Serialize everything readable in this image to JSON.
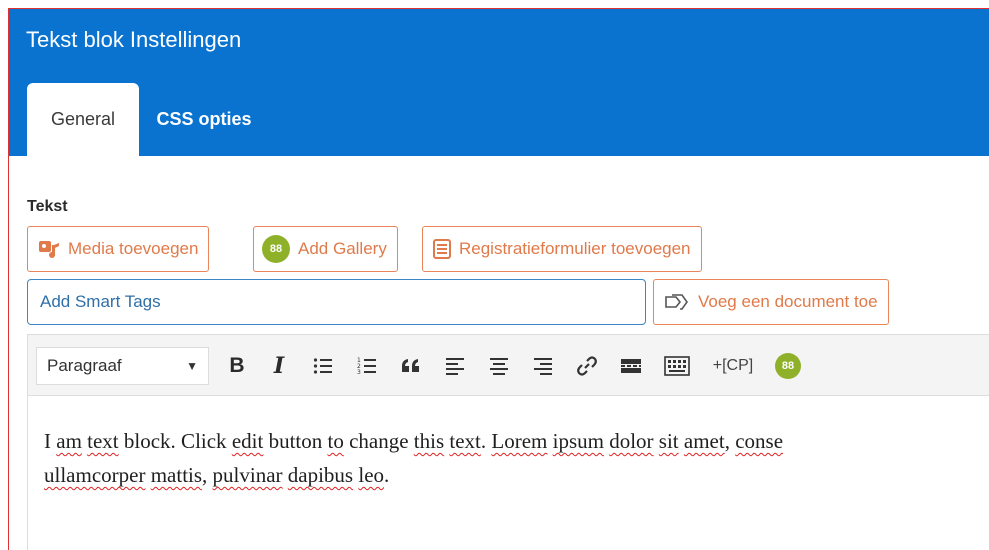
{
  "header": {
    "title": "Tekst blok Instellingen",
    "tabs": [
      {
        "label": "General",
        "active": true
      },
      {
        "label": "CSS opties",
        "active": false
      }
    ]
  },
  "field": {
    "label": "Tekst"
  },
  "buttons": {
    "media": "Media toevoegen",
    "gallery": "Add Gallery",
    "gallery_badge": "88",
    "registration": "Registratieformulier toevoegen",
    "document": "Voeg een document toe"
  },
  "smart_tags": {
    "value": "Add Smart Tags"
  },
  "toolbar": {
    "format_value": "Paragraaf",
    "bold_label": "B",
    "italic_label": "I",
    "cp_label": "+[CP]",
    "plugin_badge": "88"
  },
  "editor": {
    "line1": [
      {
        "t": "I ",
        "sq": false
      },
      {
        "t": "am",
        "sq": true
      },
      {
        "t": " ",
        "sq": false
      },
      {
        "t": "text",
        "sq": true
      },
      {
        "t": " block. Click ",
        "sq": false
      },
      {
        "t": "edit",
        "sq": true
      },
      {
        "t": " button ",
        "sq": false
      },
      {
        "t": "to",
        "sq": true
      },
      {
        "t": " change ",
        "sq": false
      },
      {
        "t": "this",
        "sq": true
      },
      {
        "t": " ",
        "sq": false
      },
      {
        "t": "text",
        "sq": true
      },
      {
        "t": ". ",
        "sq": false
      },
      {
        "t": "Lorem",
        "sq": true
      },
      {
        "t": " ",
        "sq": false
      },
      {
        "t": "ipsum",
        "sq": true
      },
      {
        "t": " ",
        "sq": false
      },
      {
        "t": "dolor",
        "sq": true
      },
      {
        "t": " ",
        "sq": false
      },
      {
        "t": "sit",
        "sq": true
      },
      {
        "t": " ",
        "sq": false
      },
      {
        "t": "amet",
        "sq": true
      },
      {
        "t": ", ",
        "sq": false
      },
      {
        "t": "conse",
        "sq": true
      }
    ],
    "line2": [
      {
        "t": "ullamcorper",
        "sq": true
      },
      {
        "t": " ",
        "sq": false
      },
      {
        "t": "mattis",
        "sq": true
      },
      {
        "t": ", ",
        "sq": false
      },
      {
        "t": "pulvinar",
        "sq": true
      },
      {
        "t": " ",
        "sq": false
      },
      {
        "t": "dapibus",
        "sq": true
      },
      {
        "t": " ",
        "sq": false
      },
      {
        "t": "leo",
        "sq": true
      },
      {
        "t": ".",
        "sq": false
      }
    ]
  },
  "colors": {
    "header_bg": "#0a73d0",
    "accent_orange": "#e07a4a",
    "input_border": "#3c86c7",
    "gallery_green": "#8fb12a",
    "spell_error": "#e02020"
  }
}
